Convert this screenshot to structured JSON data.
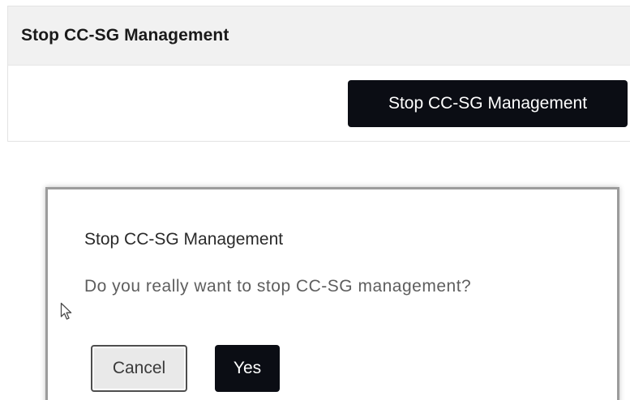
{
  "panel": {
    "title": "Stop CC-SG Management",
    "action_button_label": "Stop CC-SG Management"
  },
  "dialog": {
    "title": "Stop CC-SG Management",
    "message": "Do you really want to stop CC-SG management?",
    "cancel_label": "Cancel",
    "yes_label": "Yes"
  },
  "cursor": {
    "icon": "mouse-pointer-icon"
  },
  "colors": {
    "primary_button": "#0b0d14",
    "panel_header_bg": "#f1f1f1",
    "cancel_button_bg": "#e9e9e9"
  }
}
